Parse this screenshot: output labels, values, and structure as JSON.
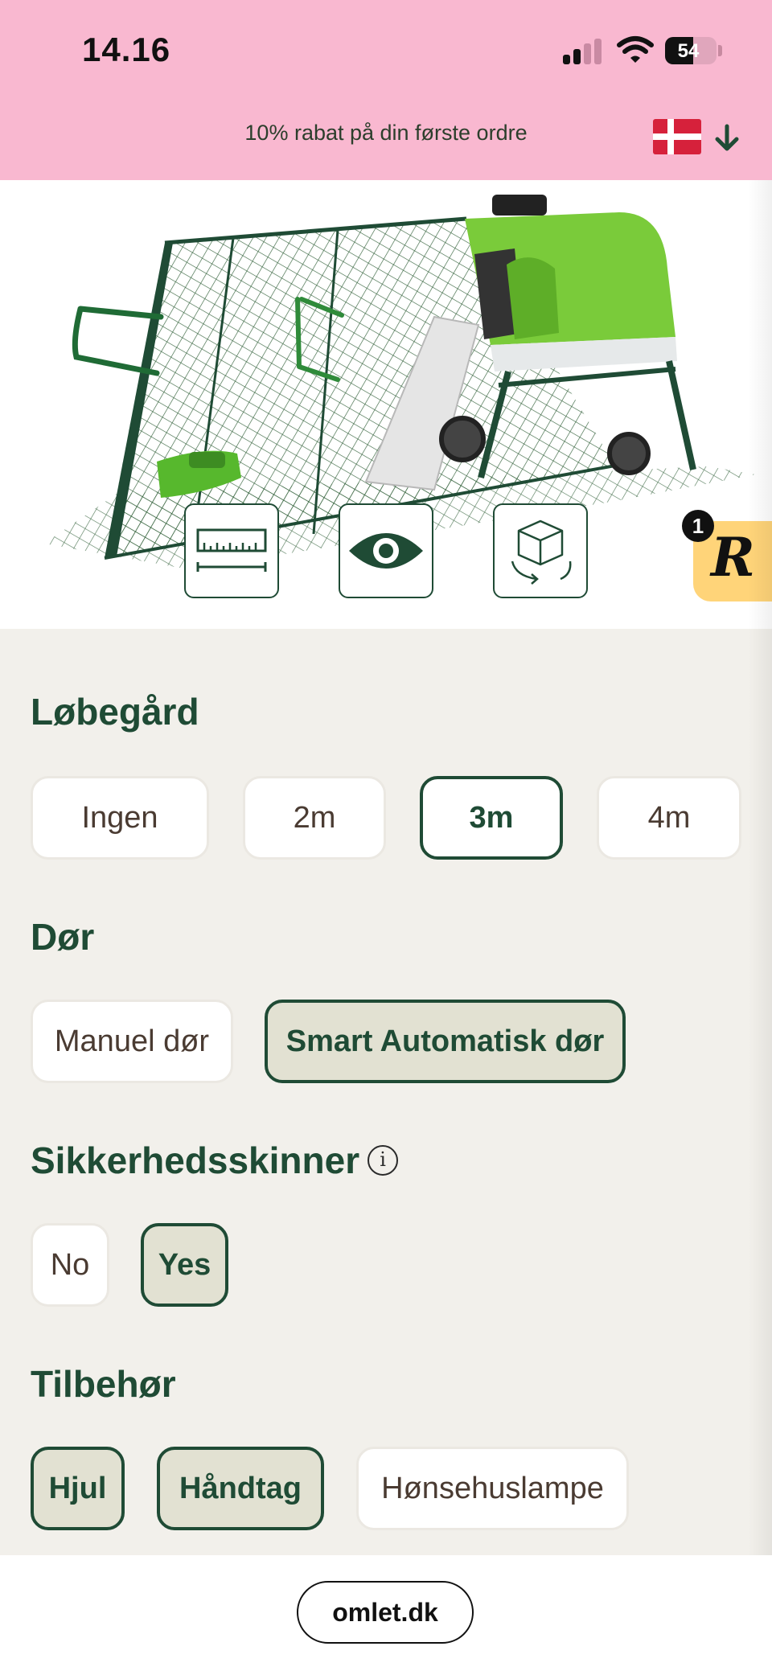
{
  "status_bar": {
    "time": "14.16",
    "battery": "54",
    "battery_level": 0.54
  },
  "promo_banner": {
    "text": "10% rabat på din første ordre",
    "flag": "denmark-flag-icon",
    "arrow": "arrow-down-icon"
  },
  "hero": {
    "buttons": [
      {
        "name": "dimensions-button",
        "icon": "ruler-icon"
      },
      {
        "name": "view-button",
        "icon": "eye-icon"
      },
      {
        "name": "rotate-3d-button",
        "icon": "cube-rotate-icon"
      }
    ],
    "reviews_widget": {
      "letter": "R",
      "badge": "1"
    }
  },
  "sections": {
    "run": {
      "title": "Løbegård",
      "options": [
        "Ingen",
        "2m",
        "3m",
        "4m"
      ],
      "selected": "3m"
    },
    "door": {
      "title": "Dør",
      "options": [
        "Manuel dør",
        "Smart Automatisk dør"
      ],
      "selected": "Smart Automatisk dør"
    },
    "safety_rails": {
      "title": "Sikkerhedsskinner",
      "info_icon": "i",
      "options": [
        "No",
        "Yes"
      ],
      "selected": "Yes"
    },
    "accessories": {
      "title": "Tilbehør",
      "options": [
        "Hjul",
        "Håndtag",
        "Hønsehuslampe"
      ],
      "selected": [
        "Hjul",
        "Håndtag"
      ]
    }
  },
  "browser": {
    "url": "omlet.dk"
  },
  "colors": {
    "brand_green": "#1f4b35",
    "banner_pink": "#f9b8d0",
    "product_green": "#7acb3a",
    "selected_fill": "#e2e1d2"
  }
}
